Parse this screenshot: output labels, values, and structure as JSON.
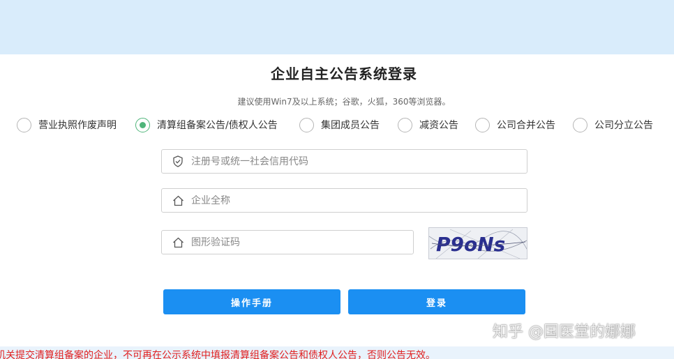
{
  "header": {
    "title": "企业自主公告系统登录",
    "browser_hint": "建议使用Win7及以上系统；谷歌，火狐，360等浏览器。"
  },
  "notice_types": [
    {
      "label": "营业执照作废声明",
      "checked": false
    },
    {
      "label": "清算组备案公告/债权人公告",
      "checked": true
    },
    {
      "label": "集团成员公告",
      "checked": false
    },
    {
      "label": "减资公告",
      "checked": false
    },
    {
      "label": "公司合并公告",
      "checked": false
    },
    {
      "label": "公司分立公告",
      "checked": false
    }
  ],
  "form": {
    "reg_code": {
      "placeholder": "注册号或统一社会信用代码",
      "value": ""
    },
    "company_name": {
      "placeholder": "企业全称",
      "value": ""
    },
    "captcha_input": {
      "placeholder": "图形验证码",
      "value": ""
    },
    "captcha_text": "P9oNs"
  },
  "buttons": {
    "manual": "操作手册",
    "login": "登录"
  },
  "watermark": "知乎 @国医堂的娜娜",
  "warning": "机关提交清算组备案的企业，不可再在公示系统中填报清算组备案公告和债权人公告，否则公告无效。",
  "colors": {
    "top_band": "#d9ecfb",
    "button": "#1b8ff2",
    "radio_checked": "#4fb57a",
    "warning": "#e02020"
  },
  "icons": {
    "reg_code": "shield-icon",
    "company_name": "home-icon",
    "captcha_input": "home-icon"
  }
}
